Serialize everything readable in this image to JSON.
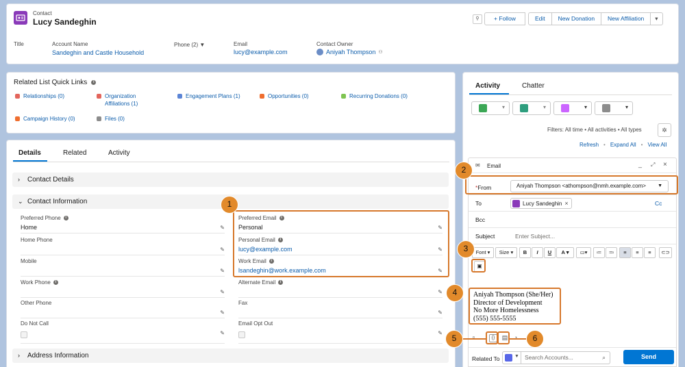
{
  "header": {
    "object_label": "Contact",
    "name": "Lucy Sandeghin",
    "buttons": [
      "Follow",
      "Edit",
      "New Donation",
      "New Affiliation"
    ],
    "follow_label": "+ Follow",
    "fields": [
      {
        "label": "Title",
        "value": ""
      },
      {
        "label": "Account Name",
        "value": "Sandeghin and Castle Household"
      },
      {
        "label": "Phone (2)",
        "value": ""
      },
      {
        "label": "Email",
        "value": "lucy@example.com"
      },
      {
        "label": "Contact Owner",
        "value": "Aniyah Thompson"
      }
    ]
  },
  "quick_links": {
    "title": "Related List Quick Links",
    "items": [
      {
        "label": "Relationships (0)",
        "color": "#e3655c"
      },
      {
        "label": "Organization Affiliations (1)",
        "color": "#e3655c"
      },
      {
        "label": "Engagement Plans (1)",
        "color": "#5c85d6"
      },
      {
        "label": "Opportunities (0)",
        "color": "#ef6e2f"
      },
      {
        "label": "Recurring Donations (0)",
        "color": "#7ec451"
      },
      {
        "label": "Campaign History (0)",
        "color": "#ef6e2f"
      },
      {
        "label": "Files (0)",
        "color": "#8c8c8c"
      }
    ]
  },
  "detail_tabs": [
    "Details",
    "Related",
    "Activity"
  ],
  "sections": {
    "contact_details": "Contact Details",
    "contact_information": "Contact Information",
    "address_information": "Address Information"
  },
  "fields_left": [
    {
      "label": "Preferred Phone",
      "value": "Home",
      "info": true
    },
    {
      "label": "Home Phone",
      "value": "",
      "info": false
    },
    {
      "label": "Mobile",
      "value": "",
      "info": false
    },
    {
      "label": "Work Phone",
      "value": "",
      "info": true
    },
    {
      "label": "Other Phone",
      "value": "",
      "info": false
    },
    {
      "label": "Do Not Call",
      "value": "",
      "info": false
    }
  ],
  "fields_right": [
    {
      "label": "Preferred Email",
      "value": "Personal",
      "info": true
    },
    {
      "label": "Personal Email",
      "value": "lucy@example.com",
      "info": true
    },
    {
      "label": "Work Email",
      "value": "lsandeghin@work.example.com",
      "info": true
    },
    {
      "label": "Alternate Email",
      "value": "",
      "info": true
    },
    {
      "label": "Fax",
      "value": "",
      "info": false
    },
    {
      "label": "Email Opt Out",
      "value": "",
      "info": false
    }
  ],
  "activity": {
    "tabs": [
      "Activity",
      "Chatter"
    ],
    "filters": "Filters: All time • All activities • All types",
    "links": [
      "Refresh",
      "Expand All",
      "View All"
    ]
  },
  "email": {
    "title": "Email",
    "from_label": "From",
    "from_value": "Aniyah Thompson <athompson@nmh.example.com>",
    "to_label": "To",
    "to_value": "Lucy Sandeghin",
    "cc_label": "Cc",
    "bcc_label": "Bcc",
    "subject_label": "Subject",
    "subject_placeholder": "Enter Subject...",
    "font_label": "Font",
    "size_label": "Size",
    "signature": [
      "Aniyah Thompson (She/Her)",
      "Director of Development",
      "No More Homelessness",
      "(555) 555-5555"
    ],
    "related_to_label": "Related To",
    "related_placeholder": "Search Accounts...",
    "send_label": "Send"
  },
  "callouts": [
    "1",
    "2",
    "3",
    "4",
    "5",
    "6"
  ],
  "colors": {
    "accent": "#0176d3",
    "callout": "#e28a2b",
    "contact_icon": "#8a3ab9"
  }
}
